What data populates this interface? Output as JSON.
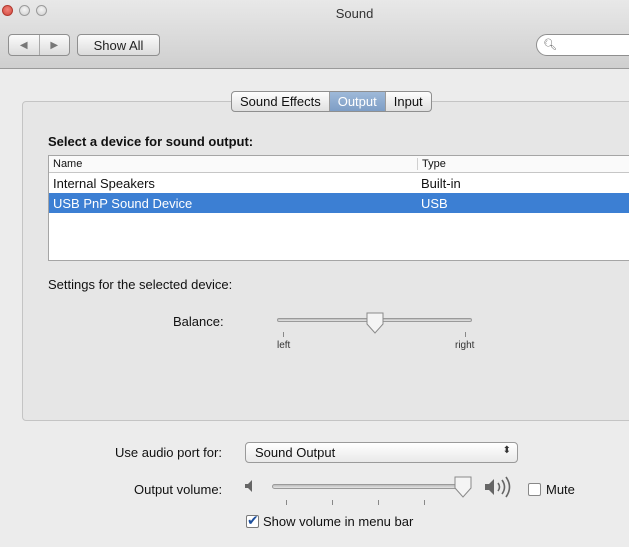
{
  "window": {
    "title": "Sound"
  },
  "toolbar": {
    "back": "◀",
    "forward": "▶",
    "show_all_label": "Show All",
    "search_placeholder": ""
  },
  "tabs": [
    {
      "label": "Sound Effects",
      "active": false
    },
    {
      "label": "Output",
      "active": true
    },
    {
      "label": "Input",
      "active": false
    }
  ],
  "output": {
    "select_label": "Select a device for sound output:",
    "columns": {
      "name": "Name",
      "type": "Type"
    },
    "devices": [
      {
        "name": "Internal Speakers",
        "type": "Built-in",
        "selected": false
      },
      {
        "name": "USB PnP Sound Device",
        "type": "USB",
        "selected": true
      }
    ],
    "settings_label": "Settings for the selected device:",
    "balance": {
      "label": "Balance:",
      "left_label": "left",
      "right_label": "right",
      "value_fraction": 0.5
    }
  },
  "footer": {
    "audio_port_label": "Use audio port for:",
    "audio_port_value": "Sound Output",
    "volume_label": "Output volume:",
    "volume_fraction": 0.95,
    "mute_label": "Mute",
    "mute_checked": false,
    "show_in_menubar_label": "Show volume in menu bar",
    "show_in_menubar_checked": true
  },
  "colors": {
    "selection": "#3c7fd3",
    "active_tab": "#8eaed3"
  }
}
